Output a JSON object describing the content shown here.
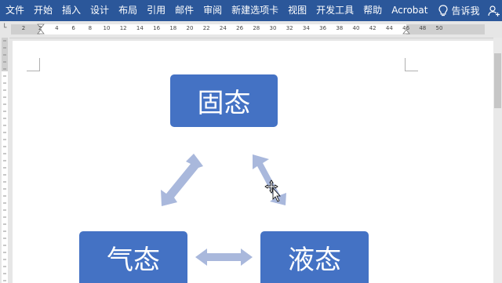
{
  "ribbon": {
    "tabs": [
      "文件",
      "开始",
      "插入",
      "设计",
      "布局",
      "引用",
      "邮件",
      "审阅",
      "新建选项卡",
      "视图",
      "开发工具",
      "帮助",
      "Acrobat"
    ],
    "tell_me": "告诉我",
    "share": "共享"
  },
  "ruler": {
    "ticks": [
      "2",
      "2",
      "4",
      "6",
      "8",
      "10",
      "12",
      "14",
      "16",
      "18",
      "20",
      "22",
      "24",
      "26",
      "28",
      "30",
      "32",
      "34",
      "36",
      "38",
      "40",
      "42",
      "44",
      "46",
      "48",
      "50"
    ]
  },
  "diagram": {
    "box_top": "固态",
    "box_left": "气态",
    "box_right": "液态"
  },
  "colors": {
    "ribbon": "#2b579a",
    "box_fill": "#4472c4",
    "arrow_fill": "#a9b8dc"
  }
}
